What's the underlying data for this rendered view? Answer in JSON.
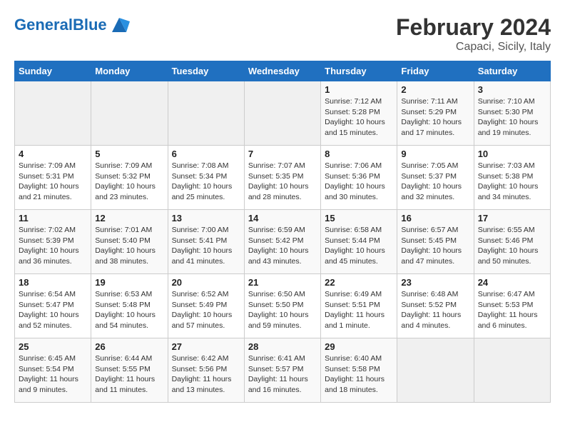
{
  "header": {
    "logo_general": "General",
    "logo_blue": "Blue",
    "title": "February 2024",
    "subtitle": "Capaci, Sicily, Italy"
  },
  "weekdays": [
    "Sunday",
    "Monday",
    "Tuesday",
    "Wednesday",
    "Thursday",
    "Friday",
    "Saturday"
  ],
  "weeks": [
    [
      {
        "day": "",
        "info": ""
      },
      {
        "day": "",
        "info": ""
      },
      {
        "day": "",
        "info": ""
      },
      {
        "day": "",
        "info": ""
      },
      {
        "day": "1",
        "info": "Sunrise: 7:12 AM\nSunset: 5:28 PM\nDaylight: 10 hours\nand 15 minutes."
      },
      {
        "day": "2",
        "info": "Sunrise: 7:11 AM\nSunset: 5:29 PM\nDaylight: 10 hours\nand 17 minutes."
      },
      {
        "day": "3",
        "info": "Sunrise: 7:10 AM\nSunset: 5:30 PM\nDaylight: 10 hours\nand 19 minutes."
      }
    ],
    [
      {
        "day": "4",
        "info": "Sunrise: 7:09 AM\nSunset: 5:31 PM\nDaylight: 10 hours\nand 21 minutes."
      },
      {
        "day": "5",
        "info": "Sunrise: 7:09 AM\nSunset: 5:32 PM\nDaylight: 10 hours\nand 23 minutes."
      },
      {
        "day": "6",
        "info": "Sunrise: 7:08 AM\nSunset: 5:34 PM\nDaylight: 10 hours\nand 25 minutes."
      },
      {
        "day": "7",
        "info": "Sunrise: 7:07 AM\nSunset: 5:35 PM\nDaylight: 10 hours\nand 28 minutes."
      },
      {
        "day": "8",
        "info": "Sunrise: 7:06 AM\nSunset: 5:36 PM\nDaylight: 10 hours\nand 30 minutes."
      },
      {
        "day": "9",
        "info": "Sunrise: 7:05 AM\nSunset: 5:37 PM\nDaylight: 10 hours\nand 32 minutes."
      },
      {
        "day": "10",
        "info": "Sunrise: 7:03 AM\nSunset: 5:38 PM\nDaylight: 10 hours\nand 34 minutes."
      }
    ],
    [
      {
        "day": "11",
        "info": "Sunrise: 7:02 AM\nSunset: 5:39 PM\nDaylight: 10 hours\nand 36 minutes."
      },
      {
        "day": "12",
        "info": "Sunrise: 7:01 AM\nSunset: 5:40 PM\nDaylight: 10 hours\nand 38 minutes."
      },
      {
        "day": "13",
        "info": "Sunrise: 7:00 AM\nSunset: 5:41 PM\nDaylight: 10 hours\nand 41 minutes."
      },
      {
        "day": "14",
        "info": "Sunrise: 6:59 AM\nSunset: 5:42 PM\nDaylight: 10 hours\nand 43 minutes."
      },
      {
        "day": "15",
        "info": "Sunrise: 6:58 AM\nSunset: 5:44 PM\nDaylight: 10 hours\nand 45 minutes."
      },
      {
        "day": "16",
        "info": "Sunrise: 6:57 AM\nSunset: 5:45 PM\nDaylight: 10 hours\nand 47 minutes."
      },
      {
        "day": "17",
        "info": "Sunrise: 6:55 AM\nSunset: 5:46 PM\nDaylight: 10 hours\nand 50 minutes."
      }
    ],
    [
      {
        "day": "18",
        "info": "Sunrise: 6:54 AM\nSunset: 5:47 PM\nDaylight: 10 hours\nand 52 minutes."
      },
      {
        "day": "19",
        "info": "Sunrise: 6:53 AM\nSunset: 5:48 PM\nDaylight: 10 hours\nand 54 minutes."
      },
      {
        "day": "20",
        "info": "Sunrise: 6:52 AM\nSunset: 5:49 PM\nDaylight: 10 hours\nand 57 minutes."
      },
      {
        "day": "21",
        "info": "Sunrise: 6:50 AM\nSunset: 5:50 PM\nDaylight: 10 hours\nand 59 minutes."
      },
      {
        "day": "22",
        "info": "Sunrise: 6:49 AM\nSunset: 5:51 PM\nDaylight: 11 hours\nand 1 minute."
      },
      {
        "day": "23",
        "info": "Sunrise: 6:48 AM\nSunset: 5:52 PM\nDaylight: 11 hours\nand 4 minutes."
      },
      {
        "day": "24",
        "info": "Sunrise: 6:47 AM\nSunset: 5:53 PM\nDaylight: 11 hours\nand 6 minutes."
      }
    ],
    [
      {
        "day": "25",
        "info": "Sunrise: 6:45 AM\nSunset: 5:54 PM\nDaylight: 11 hours\nand 9 minutes."
      },
      {
        "day": "26",
        "info": "Sunrise: 6:44 AM\nSunset: 5:55 PM\nDaylight: 11 hours\nand 11 minutes."
      },
      {
        "day": "27",
        "info": "Sunrise: 6:42 AM\nSunset: 5:56 PM\nDaylight: 11 hours\nand 13 minutes."
      },
      {
        "day": "28",
        "info": "Sunrise: 6:41 AM\nSunset: 5:57 PM\nDaylight: 11 hours\nand 16 minutes."
      },
      {
        "day": "29",
        "info": "Sunrise: 6:40 AM\nSunset: 5:58 PM\nDaylight: 11 hours\nand 18 minutes."
      },
      {
        "day": "",
        "info": ""
      },
      {
        "day": "",
        "info": ""
      }
    ]
  ]
}
